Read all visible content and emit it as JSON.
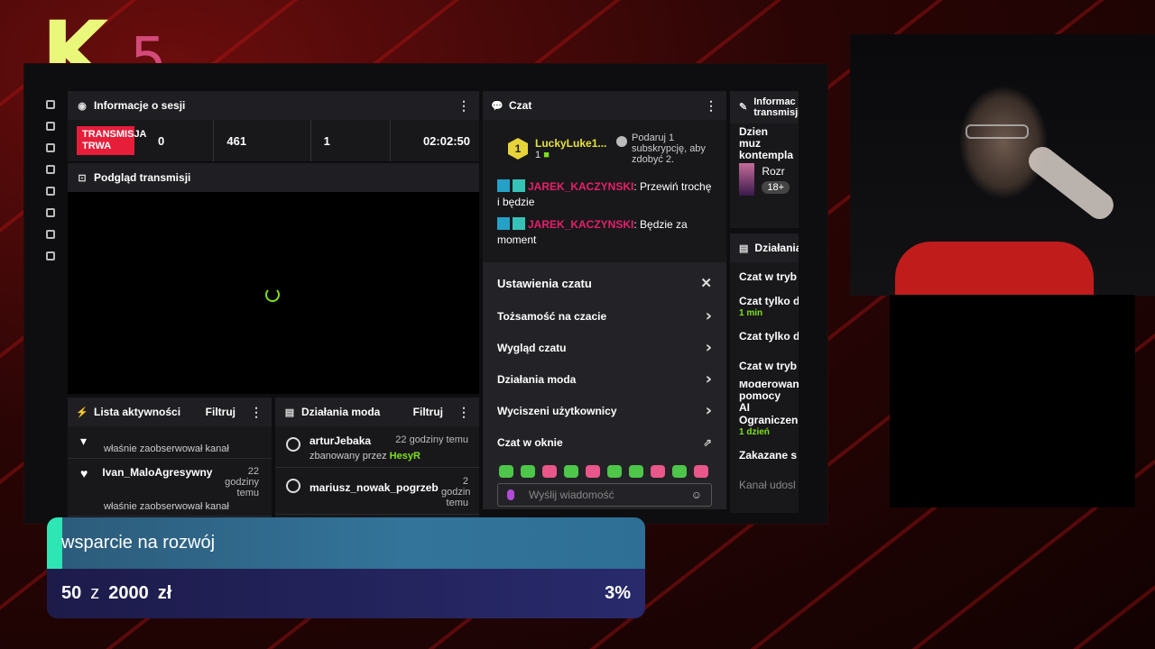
{
  "logo": {
    "letter": "K",
    "number": "5"
  },
  "session": {
    "title": "Informacje o sesji",
    "live_badge": "TRANSMISJA TRWA",
    "stats": [
      "0",
      "461",
      "1"
    ],
    "time": "02:02:50"
  },
  "preview": {
    "title": "Podgląd transmisji"
  },
  "activity": {
    "title": "Lista aktywności",
    "filter": "Filtruj",
    "items": [
      {
        "name": "",
        "text": "właśnie zaobserwował kanał",
        "time": ""
      },
      {
        "name": "Ivan_MaloAgresywny",
        "text": "właśnie zaobserwował kanał",
        "time": "22 godziny temu"
      }
    ]
  },
  "mod_actions": {
    "title": "Działania moda",
    "filter": "Filtruj",
    "items": [
      {
        "name": "arturJebaka",
        "time": "22 godziny temu",
        "sub_prefix": "zbanowany przez",
        "sub_by": "HesyR"
      },
      {
        "name": "mariusz_nowak_pogrzeb",
        "time": "2 godzin temu",
        "sub_prefix": "",
        "sub_by": ""
      }
    ]
  },
  "chat": {
    "title": "Czat",
    "top_user": "LuckyLuke1...",
    "top_rank": "1",
    "top_count": "1",
    "gift_text": "Podaruj 1 subskrypcję, aby zdobyć 2.",
    "messages": [
      {
        "user": "JAREK_KACZYNSKI",
        "text": ": Przewiń trochę i będzie"
      },
      {
        "user": "JAREK_KACZYNSKI",
        "text": ": Będzie za moment"
      }
    ],
    "settings_title": "Ustawienia czatu",
    "settings_items": [
      "Tożsamość na czacie",
      "Wygląd czatu",
      "Działania moda",
      "Wyciszeni użytkownicy",
      "Czat w oknie"
    ],
    "input_placeholder": "Wyślij wiadomość"
  },
  "right_panel": {
    "title1": "Informac transmisji",
    "stream_title": "Dzien muz kontempla",
    "category": "Rozr",
    "age": "18+",
    "title2": "Działania",
    "items": [
      {
        "label": "Czat w tryb",
        "sub": ""
      },
      {
        "label": "Czat tylko d",
        "sub": "1 min"
      },
      {
        "label": "Czat tylko d",
        "sub": ""
      },
      {
        "label": "Czat w tryb",
        "sub": ""
      },
      {
        "label": "Moderowan pomocy AI",
        "sub": ""
      },
      {
        "label": "Ograniczen",
        "sub": "1 dzień"
      },
      {
        "label": "Zakazane s",
        "sub": ""
      },
      {
        "label": "Kanał udosl",
        "sub": ""
      }
    ]
  },
  "goal": {
    "title": "wsparcie na rozwój",
    "current": "50",
    "separator": "z",
    "target": "2000",
    "currency": "zł",
    "percent_label": "3%",
    "progress_fraction": 0.025
  },
  "colors": {
    "accent_green": "#7ee01b",
    "live_red": "#e61e3a",
    "logo_yellow": "#e9f77a",
    "logo_pink": "#d44a7a"
  }
}
